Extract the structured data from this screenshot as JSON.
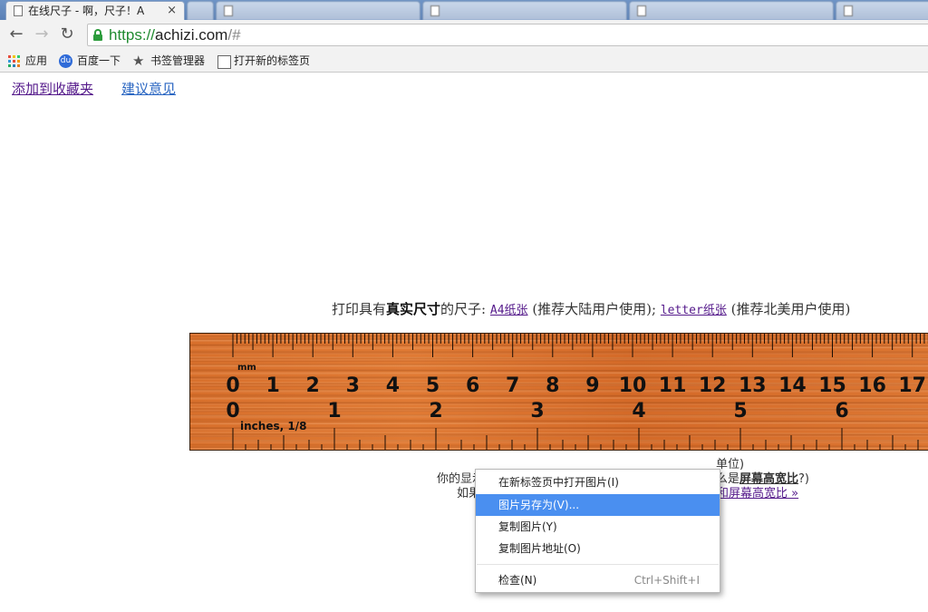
{
  "browser": {
    "active_tab": {
      "title": "在线尺子 - 啊，尺子！A",
      "close": "×"
    },
    "background_tabs": [
      "",
      "",
      "",
      ""
    ],
    "url": {
      "scheme": "https://",
      "host": "achizi.com",
      "path": "/#"
    }
  },
  "bookmarks": [
    {
      "label": "应用",
      "icon": "apps-grid-icon"
    },
    {
      "label": "百度一下",
      "icon": "baidu-paw-icon"
    },
    {
      "label": "书签管理器",
      "icon": "star-icon"
    },
    {
      "label": "打开新的标签页",
      "icon": "page-icon"
    }
  ],
  "page": {
    "top_links": [
      "添加到收藏夹",
      "建议意见"
    ],
    "print_line": {
      "prefix": "打印具有",
      "bold": "真实尺寸",
      "mid": "的尺子:",
      "a4_link": "A4纸张",
      "a4_note": "(推荐大陆用户使用);",
      "letter_link": "letter纸张",
      "letter_note": "(推荐北美用户使用)"
    },
    "ruler": {
      "mm_label": "mm",
      "mm_numbers": [
        "0",
        "1",
        "2",
        "3",
        "4",
        "5",
        "6",
        "7",
        "8",
        "9",
        "10",
        "11",
        "12",
        "13",
        "14",
        "15",
        "16",
        "17"
      ],
      "inch_label": "inches, 1/8",
      "inch_numbers": [
        "0",
        "1",
        "2",
        "3",
        "4",
        "5",
        "6"
      ]
    },
    "below_ruler": {
      "line1_right": "单位)",
      "line2_left": "你的显示",
      "line2_right_prefix": "么是",
      "line2_right_bold": "屏幕高宽比",
      "line2_right_suffix": "?)",
      "line3_left": "如果",
      "line3_right_link": "和屏幕高宽比 »"
    }
  },
  "context_menu": {
    "items": [
      {
        "label": "在新标签页中打开图片(I)",
        "highlighted": false
      },
      {
        "label": "图片另存为(V)...",
        "highlighted": true
      },
      {
        "label": "复制图片(Y)",
        "highlighted": false
      },
      {
        "label": "复制图片地址(O)",
        "highlighted": false
      }
    ],
    "inspect": {
      "label": "检查(N)",
      "shortcut": "Ctrl+Shift+I"
    }
  },
  "colors": {
    "ruler": "#d8702c",
    "menu_highlight": "#4a8ff0",
    "visited_link": "#551a8b",
    "link": "#2a66c2",
    "secure_green": "#1f8a2f"
  }
}
